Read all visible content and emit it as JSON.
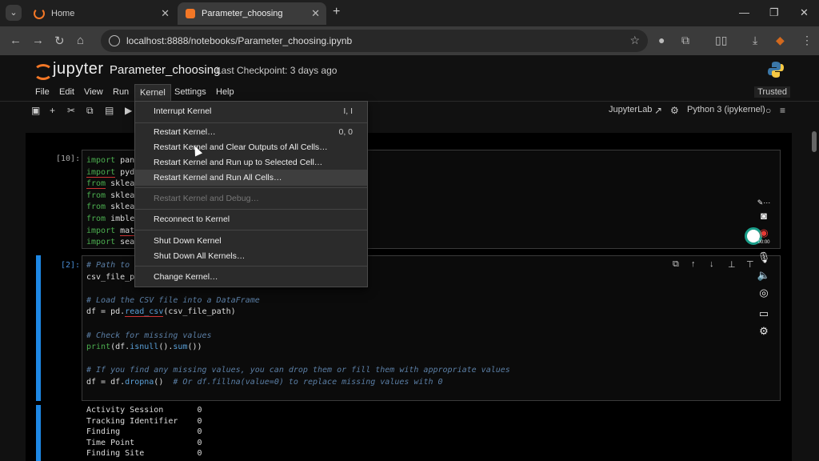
{
  "browser": {
    "tabs": [
      {
        "label": "Home",
        "active": false
      },
      {
        "label": "Parameter_choosing",
        "active": true
      }
    ],
    "new_tab": "+",
    "url": "localhost:8888/notebooks/Parameter_choosing.ipynb"
  },
  "jupyter": {
    "logo_text": "jupyter",
    "notebook_title": "Parameter_choosing",
    "checkpoint": "Last Checkpoint: 3 days ago",
    "menu": [
      "File",
      "Edit",
      "View",
      "Run",
      "Kernel",
      "Settings",
      "Help"
    ],
    "trusted": "Trusted",
    "toolbar_right": {
      "jupyterlab": "JupyterLab",
      "kernel": "Python 3 (ipykernel)"
    }
  },
  "kernel_menu": {
    "items": [
      {
        "label": "Interrupt Kernel",
        "shortcut": "I, I",
        "disabled": false,
        "highlighted": false
      },
      {
        "label": "Restart Kernel…",
        "shortcut": "0, 0",
        "disabled": false,
        "highlighted": false
      },
      {
        "label": "Restart Kernel and Clear Outputs of All Cells…",
        "shortcut": "",
        "disabled": false,
        "highlighted": false
      },
      {
        "label": "Restart Kernel and Run up to Selected Cell…",
        "shortcut": "",
        "disabled": false,
        "highlighted": false
      },
      {
        "label": "Restart Kernel and Run All Cells…",
        "shortcut": "",
        "disabled": false,
        "highlighted": true
      },
      {
        "label": "Restart Kernel and Debug…",
        "shortcut": "",
        "disabled": true,
        "highlighted": false
      },
      {
        "label": "Reconnect to Kernel",
        "shortcut": "",
        "disabled": false,
        "highlighted": false
      },
      {
        "label": "Shut Down Kernel",
        "shortcut": "",
        "disabled": false,
        "highlighted": false
      },
      {
        "label": "Shut Down All Kernels…",
        "shortcut": "",
        "disabled": false,
        "highlighted": false
      },
      {
        "label": "Change Kernel…",
        "shortcut": "",
        "disabled": false,
        "highlighted": false
      }
    ]
  },
  "cells": [
    {
      "prompt": "[10]:",
      "lines": [
        [
          {
            "t": "import",
            "c": "kw"
          },
          {
            "t": " pand",
            "c": ""
          }
        ],
        [
          {
            "t": "import",
            "c": "kw u"
          },
          {
            "t": " pydi",
            "c": ""
          }
        ],
        [
          {
            "t": "from",
            "c": "kw u"
          },
          {
            "t": " sklear",
            "c": ""
          }
        ],
        [
          {
            "t": "from",
            "c": "kw"
          },
          {
            "t": " sklear",
            "c": ""
          }
        ],
        [
          {
            "t": "from",
            "c": "kw"
          },
          {
            "t": " sklear",
            "c": ""
          }
        ],
        [
          {
            "t": "from",
            "c": "kw"
          },
          {
            "t": " imblea",
            "c": ""
          }
        ],
        [
          {
            "t": "import",
            "c": "kw"
          },
          {
            "t": " ",
            "c": ""
          },
          {
            "t": "matp",
            "c": "u"
          }
        ],
        [
          {
            "t": "import",
            "c": "kw"
          },
          {
            "t": " seab",
            "c": ""
          }
        ]
      ]
    },
    {
      "prompt": "[2]:",
      "lines": [
        [
          {
            "t": "# Path to y",
            "c": "cm"
          }
        ],
        [
          {
            "t": "csv_file_pa",
            "c": ""
          }
        ],
        [
          {
            "t": "",
            "c": ""
          }
        ],
        [
          {
            "t": "# Load the CSV file into a DataFrame",
            "c": "cm"
          }
        ],
        [
          {
            "t": "df = pd.",
            "c": ""
          },
          {
            "t": "read_csv",
            "c": "fn u"
          },
          {
            "t": "(csv_file_path)",
            "c": ""
          }
        ],
        [
          {
            "t": "",
            "c": ""
          }
        ],
        [
          {
            "t": "# Check for missing values",
            "c": "cm"
          }
        ],
        [
          {
            "t": "print",
            "c": "kw"
          },
          {
            "t": "(df.",
            "c": ""
          },
          {
            "t": "isnull",
            "c": "fn"
          },
          {
            "t": "().",
            "c": ""
          },
          {
            "t": "sum",
            "c": "fn"
          },
          {
            "t": "())",
            "c": ""
          }
        ],
        [
          {
            "t": "",
            "c": ""
          }
        ],
        [
          {
            "t": "# If you find any missing values, you can drop them or fill them with appropriate values",
            "c": "cm"
          }
        ],
        [
          {
            "t": "df = df.",
            "c": ""
          },
          {
            "t": "dropna",
            "c": "fn"
          },
          {
            "t": "()  ",
            "c": ""
          },
          {
            "t": "# Or df.fillna(value=0) to replace missing values with 0",
            "c": "cm"
          }
        ]
      ]
    }
  ],
  "output": [
    "Activity Session       0",
    "Tracking Identifier    0",
    "Finding                0",
    "Time Point             0",
    "Finding Site           0"
  ],
  "recorder": {
    "timer": "00:00"
  }
}
